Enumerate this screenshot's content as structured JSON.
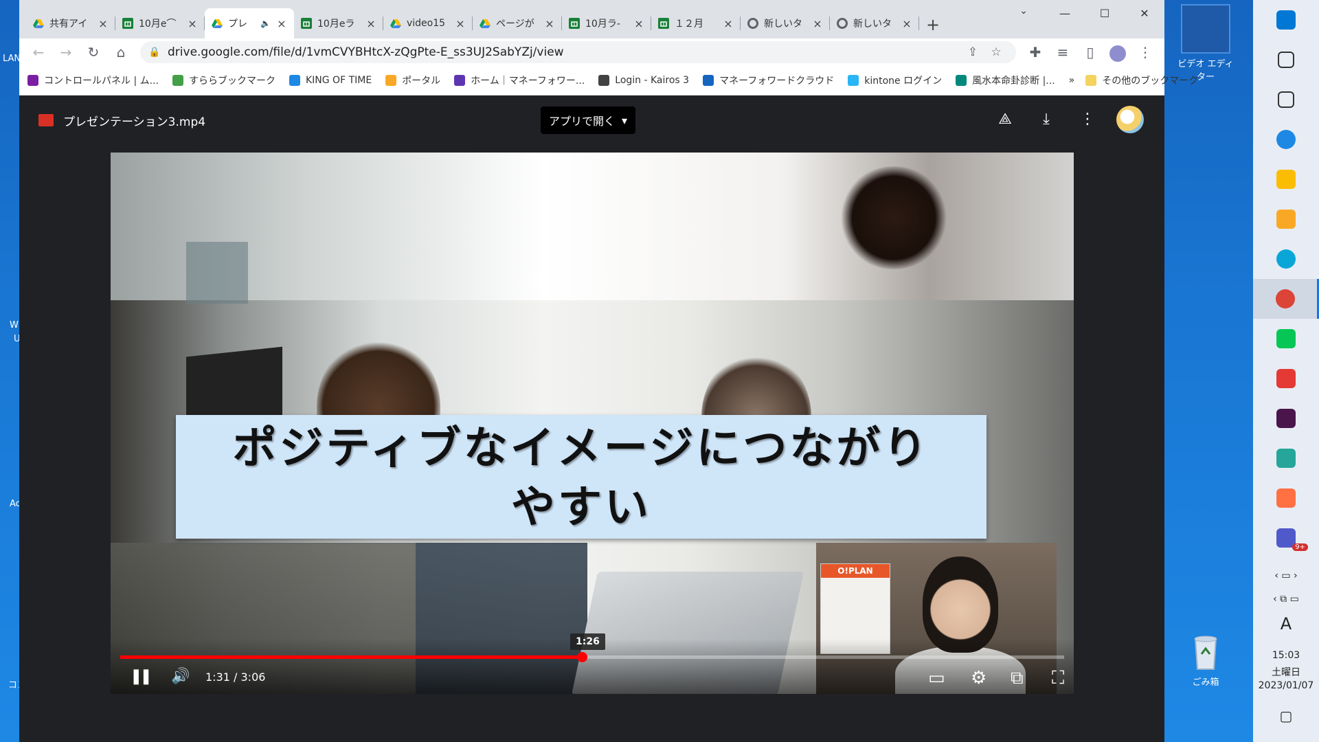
{
  "tabs": [
    {
      "title": "共有アイ",
      "favicon": "drive",
      "color": "#1e8e3e",
      "active": false
    },
    {
      "title": "10月e⌒",
      "favicon": "sheets",
      "color": "#188038",
      "active": false
    },
    {
      "title": "プレ",
      "favicon": "drive",
      "color": "#1e8e3e",
      "active": true,
      "audio": "🔈"
    },
    {
      "title": "10月eラ",
      "favicon": "sheets",
      "color": "#188038",
      "active": false
    },
    {
      "title": "video15",
      "favicon": "drive",
      "color": "#1e8e3e",
      "active": false
    },
    {
      "title": "ページが",
      "favicon": "drive",
      "color": "#1e8e3e",
      "active": false
    },
    {
      "title": "10月ラ-",
      "favicon": "sheets",
      "color": "#188038",
      "active": false
    },
    {
      "title": "１２月",
      "favicon": "sheets",
      "color": "#188038",
      "active": false
    },
    {
      "title": "新しいタ",
      "favicon": "chrome",
      "color": "#5f6368",
      "active": false
    },
    {
      "title": "新しいタ",
      "favicon": "chrome",
      "color": "#5f6368",
      "active": false
    }
  ],
  "newtab_label": "+",
  "window_controls": {
    "minimize": "—",
    "maximize": "☐",
    "close": "✕"
  },
  "tab_search": "⌄",
  "toolbar": {
    "back": "←",
    "forward": "→",
    "reload": "↻",
    "home": "⌂",
    "url": "drive.google.com/file/d/1vmCVYBHtcX-zQgPte-E_ss3UJ2SabYZj/view",
    "lock": "🔒",
    "share": "⇪",
    "star": "☆",
    "extensions": "✚",
    "media": "≡",
    "sidepanel": "▯",
    "menu": "⋮"
  },
  "bookmarks": [
    {
      "label": "コントロールパネル | ム...",
      "color": "#7b1fa2"
    },
    {
      "label": "すららブックマーク",
      "color": "#43a047"
    },
    {
      "label": "KING OF TIME",
      "color": "#1e88e5"
    },
    {
      "label": "ポータル",
      "color": "#f9a825"
    },
    {
      "label": "ホーム｜マネーフォワー...",
      "color": "#5e35b1"
    },
    {
      "label": "Login - Kairos 3",
      "color": "#424242"
    },
    {
      "label": "マネーフォワードクラウド",
      "color": "#1565c0"
    },
    {
      "label": "kintone ログイン",
      "color": "#29b6f6"
    },
    {
      "label": "風水本命卦診断 |...",
      "color": "#00897b"
    }
  ],
  "bookmarks_more": "»",
  "other_bookmarks": "その他のブックマーク",
  "viewer": {
    "filename": "プレゼンテーション3.mp4",
    "open_with": "アプリで開く",
    "open_with_caret": "▾",
    "add_shortcut_icon": "⟁",
    "download_icon": "⤓",
    "more_icon": "⋮"
  },
  "video": {
    "caption_line1": "ポジティブなイメージにつながり",
    "caption_line2": "やすい",
    "calendar_text": "O!PLAN",
    "hover_time": "1:26",
    "current_time": "1:31",
    "duration": "3:06",
    "time_display": "1:31 / 3:06",
    "progress_fraction": 0.489,
    "pause_icon": "❚❚",
    "volume_icon": "🔊",
    "subtitles_icon": "▭",
    "settings_icon": "⚙",
    "miniplayer_icon": "⧉",
    "fullscreen_icon": "⛶"
  },
  "desktop": {
    "edge_labels": [
      "LAN",
      "W",
      "U",
      "Ac",
      "コン"
    ],
    "video_editor_label": "ビデオ エディター",
    "recycle_bin_label": "ごみ箱"
  },
  "taskbar": {
    "apps": [
      {
        "name": "windows-start",
        "color": "#0078d4"
      },
      {
        "name": "search",
        "color": "#333333"
      },
      {
        "name": "task-view",
        "color": "#333333"
      },
      {
        "name": "app-bird",
        "color": "#1e88e5"
      },
      {
        "name": "google-drive",
        "color": "#fbbc04"
      },
      {
        "name": "file-explorer",
        "color": "#f9a825"
      },
      {
        "name": "edge",
        "color": "#0aa6d8"
      },
      {
        "name": "chrome",
        "color": "#db4437",
        "active": true
      },
      {
        "name": "line",
        "color": "#06c755"
      },
      {
        "name": "app-red",
        "color": "#e53935"
      },
      {
        "name": "slack",
        "color": "#4a154b"
      },
      {
        "name": "app-paper",
        "color": "#26a69a"
      },
      {
        "name": "paint",
        "color": "#ff7043"
      },
      {
        "name": "teams-badge",
        "color": "#5059c9",
        "badge": "9+"
      }
    ],
    "ime": "A",
    "time": "15:03",
    "day": "土曜日",
    "date": "2023/01/07"
  }
}
